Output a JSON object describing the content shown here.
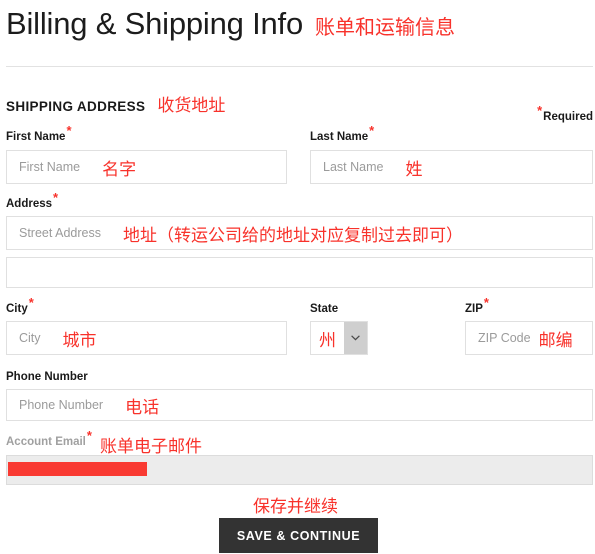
{
  "header": {
    "title": "Billing & Shipping Info",
    "title_annotation": "账单和运输信息"
  },
  "section": {
    "heading": "SHIPPING ADDRESS",
    "heading_annotation": "收货地址",
    "required_note": "Required"
  },
  "fields": {
    "first_name": {
      "label": "First Name",
      "placeholder": "First Name",
      "value": "",
      "annotation": "名字",
      "required": true
    },
    "last_name": {
      "label": "Last Name",
      "placeholder": "Last Name",
      "value": "",
      "annotation": "姓",
      "required": true
    },
    "address1": {
      "label": "Address",
      "placeholder": "Street Address",
      "value": "",
      "annotation": "地址（转运公司给的地址对应复制过去即可）",
      "required": true
    },
    "address2": {
      "label": "",
      "placeholder": "",
      "value": "",
      "annotation": "",
      "required": false
    },
    "city": {
      "label": "City",
      "placeholder": "City",
      "value": "",
      "annotation": "城市",
      "required": true
    },
    "state": {
      "label": "State",
      "selected": "",
      "annotation": "州",
      "required": false,
      "arrow_icon": "chevron-down-icon"
    },
    "zip": {
      "label": "ZIP",
      "placeholder": "ZIP Code",
      "value": "",
      "annotation": "邮编",
      "required": true
    },
    "phone": {
      "label": "Phone Number",
      "placeholder": "Phone Number",
      "value": "",
      "annotation": "电话",
      "required": false
    },
    "account_email": {
      "label": "Account Email",
      "placeholder": "",
      "value": "",
      "annotation": "账单电子邮件",
      "required": true,
      "disabled": true,
      "redacted": true
    }
  },
  "actions": {
    "save_label": "SAVE & CONTINUE",
    "save_annotation": "保存并继续"
  },
  "colors": {
    "annotation_red": "#f8322b",
    "button_dark": "#333333",
    "field_border": "#e0e0e0",
    "disabled_bg": "#ececec",
    "redaction": "#f93a32"
  }
}
